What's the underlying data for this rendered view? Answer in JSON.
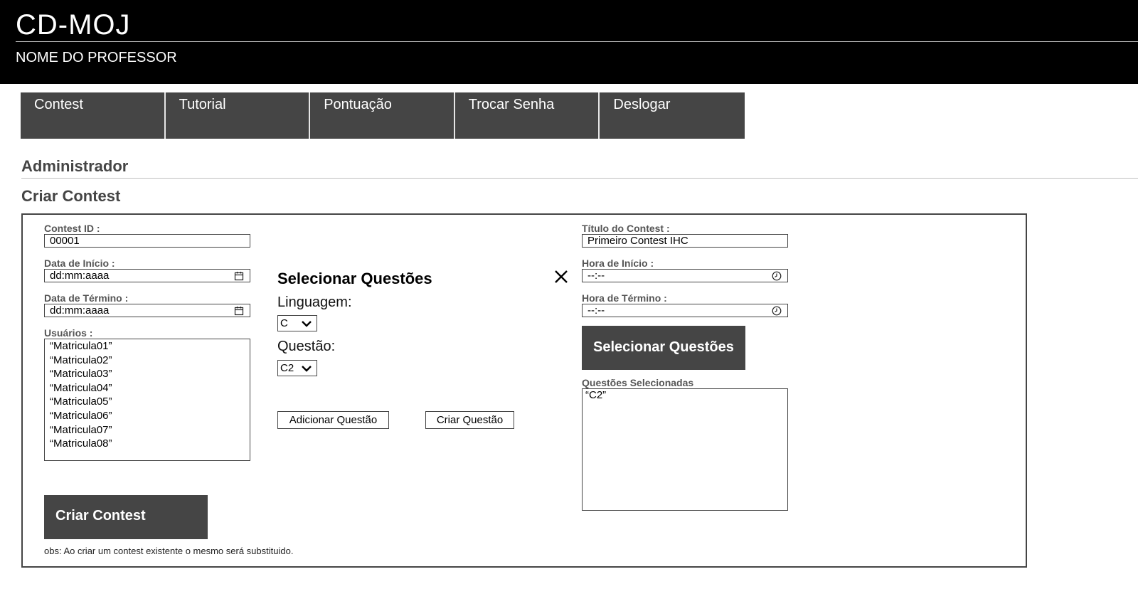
{
  "header": {
    "app_title": "CD-MOJ",
    "professor_name": "NOME DO PROFESSOR"
  },
  "nav": {
    "items": [
      {
        "label": "Contest"
      },
      {
        "label": "Tutorial"
      },
      {
        "label": "Pontuação"
      },
      {
        "label": "Trocar Senha"
      },
      {
        "label": "Deslogar"
      }
    ]
  },
  "page": {
    "section_title": "Administrador",
    "sub_title": "Criar Contest"
  },
  "form": {
    "contest_id_label": "Contest ID :",
    "contest_id_value": "00001",
    "start_date_label": "Data de Início :",
    "start_date_value": "dd:mm:aaaa",
    "end_date_label": "Data de Término :",
    "end_date_value": "dd:mm:aaaa",
    "users_label": "Usuários :",
    "users": [
      "“Matricula01”",
      "“Matricula02”",
      "“Matricula03”",
      "“Matricula04”",
      "“Matricula05”",
      "“Matricula06”",
      "“Matricula07”",
      "“Matricula08”"
    ],
    "title_label": "Título do Contest :",
    "title_value": "Primeiro Contest IHC",
    "start_time_label": "Hora de Início :",
    "start_time_value": "--:--",
    "end_time_label": "Hora de Término :",
    "end_time_value": "--:--",
    "select_questions_button": "Selecionar Questões",
    "selected_questions_label": "Questões Selecionadas",
    "selected_questions": [
      "“C2”"
    ],
    "create_button": "Criar Contest",
    "obs": "obs: Ao criar um contest existente o mesmo será substituido."
  },
  "modal": {
    "title": "Selecionar Questões",
    "language_label": "Linguagem:",
    "language_value": "C",
    "question_label": "Questão:",
    "question_value": "C2",
    "add_button": "Adicionar Questão",
    "create_button": "Criar Questão"
  },
  "icons": {
    "date": "calendar-icon",
    "time": "clock-icon",
    "dropdown": "chevron-down-icon",
    "close": "close-icon"
  },
  "colors": {
    "header_bg": "#000000",
    "nav_bg": "#454545",
    "button_bg": "#454545",
    "heading": "#454545"
  }
}
